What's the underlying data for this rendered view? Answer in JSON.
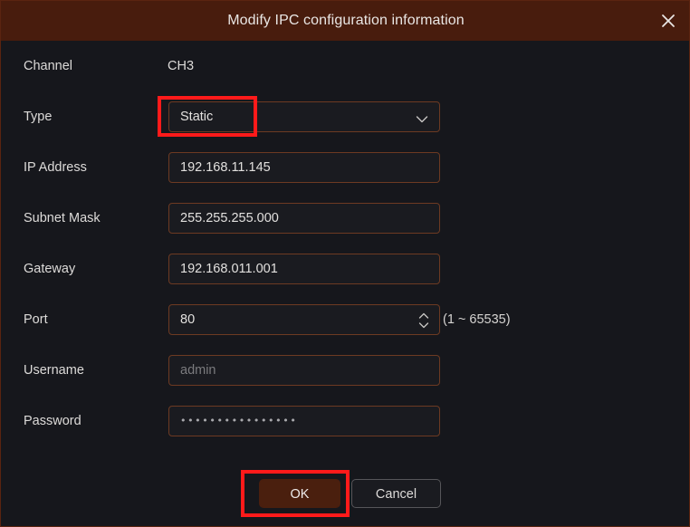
{
  "dialog": {
    "title": "Modify IPC configuration information",
    "close_icon": "close-icon",
    "title_bar_color": "#481c0d",
    "body_color": "#16171c",
    "accent_color": "#6d3a22",
    "annotation_color": "#ff1a1a"
  },
  "form": {
    "rows": [
      {
        "label": "Channel",
        "value": "CH3",
        "kind": "text"
      },
      {
        "label": "Type",
        "value": "Static",
        "kind": "select"
      },
      {
        "label": "IP Address",
        "value": "192.168.11.145",
        "kind": "input"
      },
      {
        "label": "Subnet Mask",
        "value": "255.255.255.000",
        "kind": "input"
      },
      {
        "label": "Gateway",
        "value": "192.168.011.001",
        "kind": "input"
      },
      {
        "label": "Port",
        "value": "80",
        "kind": "number",
        "hint": "(1 ~ 65535)"
      },
      {
        "label": "Username",
        "value": "",
        "placeholder": "admin",
        "kind": "input"
      },
      {
        "label": "Password",
        "value": "••••••••••••••••",
        "kind": "password"
      }
    ]
  },
  "footer": {
    "ok_label": "OK",
    "cancel_label": "Cancel"
  }
}
